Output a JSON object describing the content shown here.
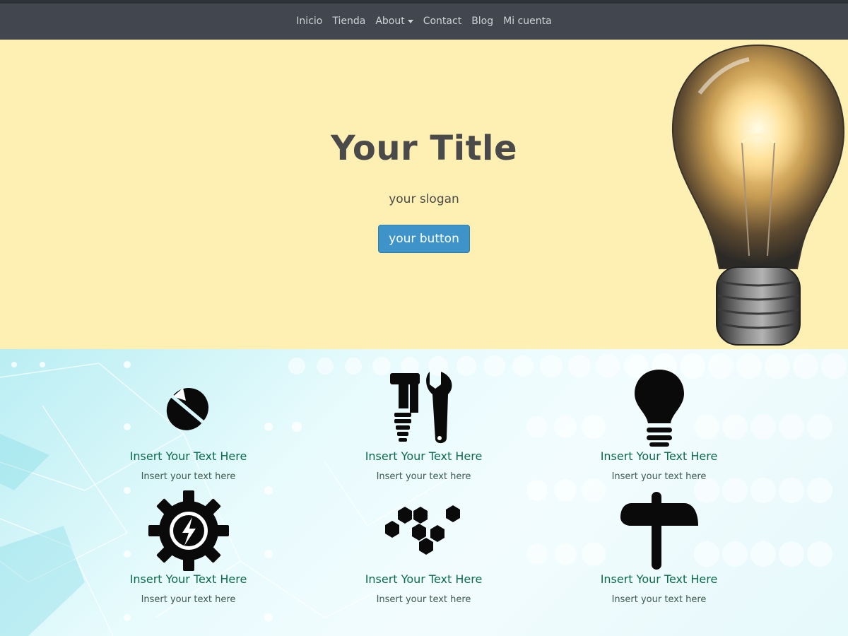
{
  "navbar": {
    "items": [
      {
        "label": "Inicio"
      },
      {
        "label": "Tienda"
      },
      {
        "label": "About"
      },
      {
        "label": "Contact"
      },
      {
        "label": "Blog"
      },
      {
        "label": "Mi cuenta"
      }
    ]
  },
  "hero": {
    "title": "Your Title",
    "slogan": "your slogan",
    "button_label": "your button",
    "image_icon": "light-bulb-photo"
  },
  "features": [
    {
      "icon": "pill-capsule-icon",
      "title": "Insert Your Text Here",
      "text": "Insert your text here"
    },
    {
      "icon": "tools-hammer-wrench-icon",
      "title": "Insert Your Text Here",
      "text": "Insert your text here"
    },
    {
      "icon": "lightbulb-icon",
      "title": "Insert Your Text Here",
      "text": "Insert your text here"
    },
    {
      "icon": "gear-lightning-icon",
      "title": "Insert Your Text Here",
      "text": "Insert your text here"
    },
    {
      "icon": "hexagons-molecule-icon",
      "title": "Insert Your Text Here",
      "text": "Insert your text here"
    },
    {
      "icon": "signpost-icon",
      "title": "Insert Your Text Here",
      "text": "Insert your text here"
    }
  ],
  "colors": {
    "navbar_bg": "#41464f",
    "hero_bg": "#feefb2",
    "button_bg": "#3e93c8",
    "feature_title": "#0b6b4a"
  }
}
